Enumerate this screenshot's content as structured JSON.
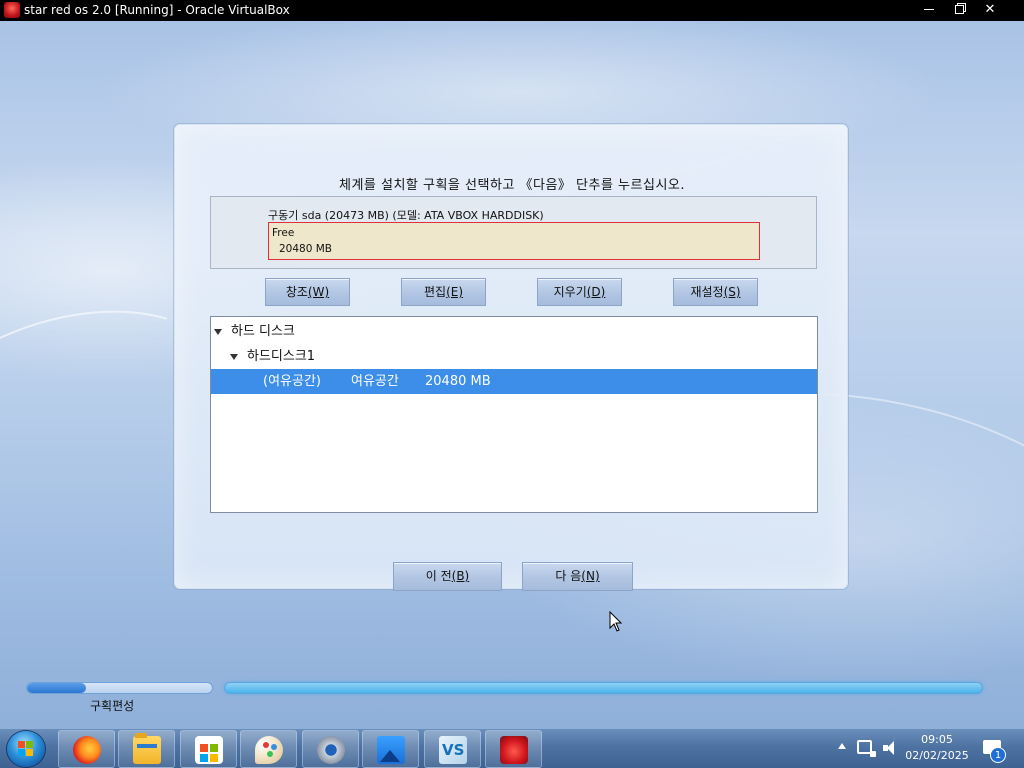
{
  "window": {
    "title": "star red os 2.0 [Running] - Oracle VirtualBox",
    "minimize_label": "",
    "close_glyph": "✕"
  },
  "installer": {
    "instruction": "체계를 설치할 구획을 선택하고 《다음》 단추를 누르십시오.",
    "drive_label": "구동기 sda (20473 MB) (모델: ATA VBOX HARDDISK)",
    "free_block": {
      "name": "Free",
      "size": "20480 MB"
    },
    "buttons": {
      "create": {
        "text": "창조",
        "key": "(W)"
      },
      "edit": {
        "text": "편집",
        "key": "(E)"
      },
      "delete": {
        "text": "지우기",
        "key": "(D)"
      },
      "reset": {
        "text": "재설정",
        "key": "(S)"
      }
    },
    "tree": {
      "root": "하드 디스크",
      "disk": "하드디스크1",
      "selected_row": {
        "device": "(여유공간)",
        "type": "여유공간",
        "size": "20480 MB"
      }
    },
    "nav": {
      "back": {
        "text": "이 전",
        "key": "(B)"
      },
      "next": {
        "text": "다 음",
        "key": "(N)"
      }
    }
  },
  "progress": {
    "step_label": "구획편성",
    "step_fraction": 0.32,
    "overall_fraction": 1.0
  },
  "taskbar": {
    "apps": [
      "firefox-icon",
      "file-explorer-icon",
      "microsoft-store-icon",
      "paint-icon",
      "settings-icon",
      "photos-icon",
      "visual-studio-icon",
      "virtualbox-icon"
    ],
    "clock": {
      "time": "09:05",
      "date": "02/02/2025"
    },
    "notification_count": "1"
  },
  "colors": {
    "selection": "#3d8ee9",
    "free_border": "#e0303a",
    "free_fill": "#efe7cc",
    "progress": "#4ab2ec"
  }
}
